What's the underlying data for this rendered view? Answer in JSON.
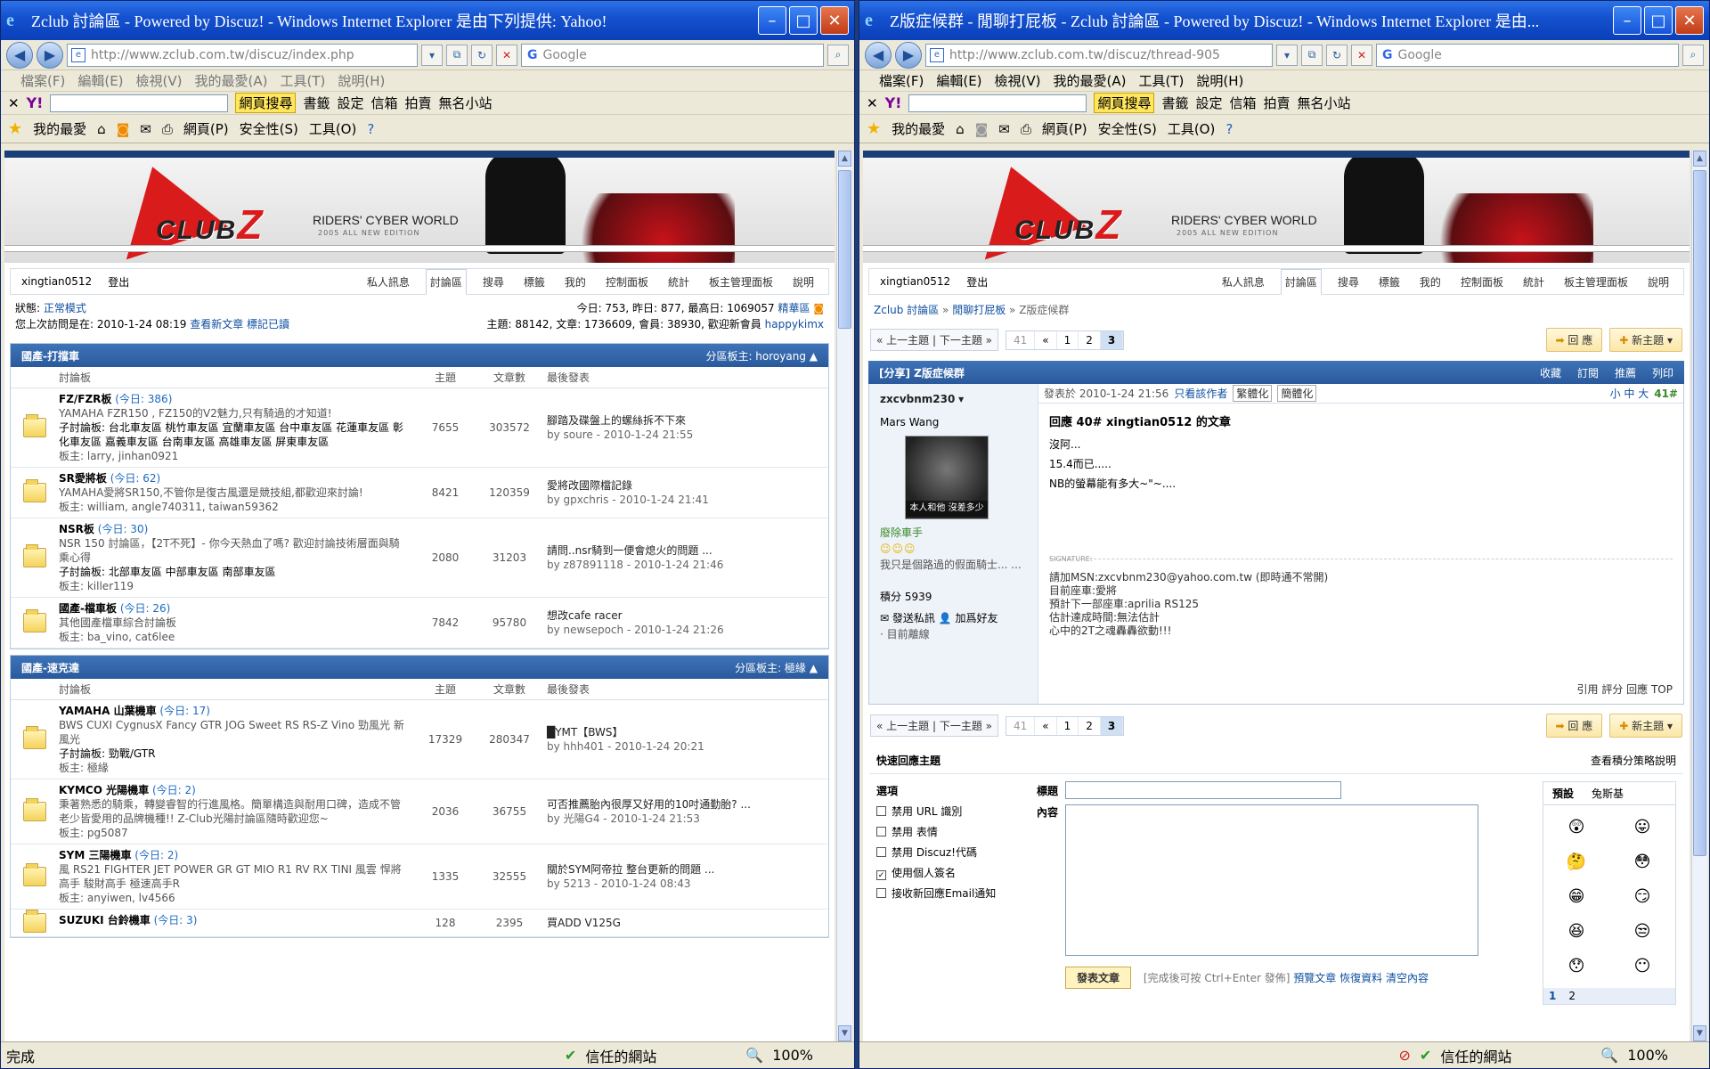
{
  "left": {
    "title": "Zclub 討論區 - Powered by Discuz! - Windows Internet Explorer 是由下列提供: Yahoo!",
    "url": "http://www.zclub.com.tw/discuz/index.php",
    "search_placeholder": "Google",
    "menu": [
      "檔案(F)",
      "編輯(E)",
      "檢視(V)",
      "我的最愛(A)",
      "工具(T)",
      "說明(H)"
    ],
    "yahoo": {
      "search_btn": "網頁搜尋",
      "items": [
        "書籤",
        "設定",
        "信箱",
        "拍賣",
        "無名小站"
      ]
    },
    "fav": {
      "label": "我的最愛",
      "items": [
        "網頁(P)",
        "安全性(S)",
        "工具(O)"
      ]
    },
    "status": {
      "text": "完成",
      "zone": "信任的網站",
      "zoom": "100%"
    },
    "forum": {
      "user": "xingtian0512",
      "logout": "登出",
      "tabs": [
        "私人訊息",
        "討論區",
        "搜尋",
        "標籤",
        "我的",
        "控制面板",
        "統計",
        "板主管理面板",
        "說明"
      ],
      "state_label": "狀態:",
      "state_value": "正常模式",
      "last_visit": "您上次訪問是在: 2010-1-24 08:19",
      "view_new": "查看新文章",
      "mark_read": "標記已讀",
      "today_stats": "今日: 753, 昨日: 877, 最高日: 1069057",
      "archive": "精華區",
      "totals": "主題: 88142, 文章: 1736609, 會員: 38930, 歡迎新會員",
      "new_member": "happykimx",
      "sections": [
        {
          "name": "國產-打擋車",
          "moderator": "分區板主: horoyang",
          "cols": [
            "討論板",
            "主題",
            "文章數",
            "最後發表"
          ],
          "rows": [
            {
              "name": "FZ/FZR板",
              "today": "(今日: 386)",
              "desc": "YAMAHA FZR150 , FZ150的V2魅力,只有騎過的才知道!",
              "sub": "子討論板: 台北車友區 桃竹車友區 宜蘭車友區 台中車友區 花蓮車友區 彰化車友區 嘉義車友區 台南車友區 高雄車友區 屏東車友區",
              "mods": "板主: larry, jinhan0921",
              "topics": "7655",
              "posts": "303572",
              "last_title": "腳踏及碟盤上的螺絲拆不下來",
              "last_by": "by soure - 2010-1-24 21:55"
            },
            {
              "name": "SR愛將板",
              "today": "(今日: 62)",
              "desc": "YAMAHA愛將SR150,不管你是復古風還是競技組,都歡迎來討論!",
              "sub": "",
              "mods": "板主: william, angle740311, taiwan59362",
              "topics": "8421",
              "posts": "120359",
              "last_title": "愛將改國際檔記錄",
              "last_by": "by gpxchris - 2010-1-24 21:41"
            },
            {
              "name": "NSR板",
              "today": "(今日: 30)",
              "desc": "NSR 150 討論區，【2T不死】- 你今天熱血了嗎? 歡迎討論技術層面與騎乘心得",
              "sub": "子討論板: 北部車友區 中部車友區 南部車友區",
              "mods": "板主: killer119",
              "topics": "2080",
              "posts": "31203",
              "last_title": "請問..nsr騎到一便會熄火的問題 ...",
              "last_by": "by z87891118 - 2010-1-24 21:46"
            },
            {
              "name": "國產-檔車板",
              "today": "(今日: 26)",
              "desc": "其他國產檔車綜合討論板",
              "sub": "",
              "mods": "板主: ba_vino, cat6lee",
              "topics": "7842",
              "posts": "95780",
              "last_title": "想改cafe racer",
              "last_by": "by newsepoch - 2010-1-24 21:26"
            }
          ]
        },
        {
          "name": "國產-速克達",
          "moderator": "分區板主: 極緣",
          "cols": [
            "討論板",
            "主題",
            "文章數",
            "最後發表"
          ],
          "rows": [
            {
              "name": "YAMAHA 山葉機車",
              "today": "(今日: 17)",
              "desc": "BWS CUXI CygnusX Fancy GTR JOG Sweet RS RS-Z Vino 勁風光 新風光",
              "sub": "子討論板: 勁戰/GTR",
              "mods": "板主: 極緣",
              "topics": "17329",
              "posts": "280347",
              "last_title": "█YMT【BWS】",
              "last_by": "by hhh401 - 2010-1-24 20:21"
            },
            {
              "name": "KYMCO 光陽機車",
              "today": "(今日: 2)",
              "desc": "秉著熟悉的騎乘，轉變睿智的行進風格。簡單構造與耐用口碑，造成不管老少皆愛用的品牌機種!! Z-Club光陽討論區隨時歡迎您~",
              "sub": "",
              "mods": "板主: pg5087",
              "topics": "2036",
              "posts": "36755",
              "last_title": "可否推薦胎內很厚又好用的10吋通勤胎? ...",
              "last_by": "by 光陽G4 - 2010-1-24 21:53"
            },
            {
              "name": "SYM 三陽機車",
              "today": "(今日: 2)",
              "desc": "風 RS21 FIGHTER JET POWER GR GT MIO R1 RV RX TINI 風雲 悍將 高手 駿財高手 極速高手R",
              "sub": "",
              "mods": "板主: anyiwen, lv4566",
              "topics": "1335",
              "posts": "32555",
              "last_title": "關於SYM阿帝拉 整台更新的問題 ...",
              "last_by": "by 5213 - 2010-1-24 08:43"
            },
            {
              "name": "SUZUKI 台鈴機車",
              "today": "(今日: 3)",
              "desc": "",
              "sub": "",
              "mods": "",
              "topics": "128",
              "posts": "2395",
              "last_title": "買ADD V125G",
              "last_by": ""
            }
          ]
        }
      ]
    }
  },
  "right": {
    "title": "Z版症候群 - 閒聊打屁板 - Zclub 討論區 - Powered by Discuz! - Windows Internet Explorer 是由...",
    "url": "http://www.zclub.com.tw/discuz/thread-905",
    "search_placeholder": "Google",
    "menu": [
      "檔案(F)",
      "編輯(E)",
      "檢視(V)",
      "我的最愛(A)",
      "工具(T)",
      "說明(H)"
    ],
    "yahoo": {
      "search_btn": "網頁搜尋",
      "items": [
        "書籤",
        "設定",
        "信箱",
        "拍賣",
        "無名小站"
      ]
    },
    "fav": {
      "label": "我的最愛",
      "items": [
        "網頁(P)",
        "安全性(S)",
        "工具(O)"
      ]
    },
    "status": {
      "zone": "信任的網站",
      "zoom": "100%"
    },
    "forum": {
      "user": "xingtian0512",
      "logout": "登出",
      "tabs": [
        "私人訊息",
        "討論區",
        "搜尋",
        "標籤",
        "我的",
        "控制面板",
        "統計",
        "板主管理面板",
        "說明"
      ],
      "crumbs": [
        "Zclub 討論區",
        "閒聊打屁板",
        "Z版症候群"
      ],
      "prev_next": "« 上一主題 | 下一主題 »",
      "pages": [
        "41",
        "«",
        "1",
        "2",
        "3"
      ],
      "reply_btn": "回 應",
      "new_btn": "新主題",
      "thread_title": "[分享] Z版症候群",
      "thread_actions": [
        "收藏",
        "訂閱",
        "推薦",
        "列印"
      ],
      "post": {
        "author": "zxcvbnm230",
        "realname": "Mars Wang",
        "avatar_caption": "本人和他 沒差多少",
        "rank": "廢除車手",
        "stars": "☺☺☺",
        "bio": "我只是個路過的假面騎士... ...",
        "points_label": "積分",
        "points": "5939",
        "send_pm": "發送私訊",
        "add_friend": "加爲好友",
        "offline": "目前離線",
        "posted": "發表於 2010-1-24 21:56",
        "only_author": "只看該作者",
        "trad": "繁體化",
        "simp": "簡體化",
        "sizes": "小 中 大",
        "floor": "41#",
        "title": "回應 40# xingtian0512 的文章",
        "lines": [
          "沒阿...",
          "15.4而已.....",
          "NB的螢幕能有多大~\"~...."
        ],
        "sig_label": "SIGNATURE:",
        "sig": [
          "請加MSN:zxcvbnm230@yahoo.com.tw (即時通不常開)",
          "目前座車:愛將",
          "預計下一部座車:aprilia RS125",
          "估計達成時間:無法估計",
          "心中的2T之魂轟轟欲動!!!"
        ],
        "footer": "引用 評分 回應 TOP"
      },
      "quick_reply": {
        "head": "快速回應主題",
        "rules": "查看積分策略說明",
        "options_label": "選項",
        "options": [
          "禁用 URL 識別",
          "禁用 表情",
          "禁用 Discuz!代碼",
          "使用個人簽名",
          "接收新回應Email通知"
        ],
        "checked": [
          false,
          false,
          false,
          true,
          false
        ],
        "title_label": "標題",
        "content_label": "內容",
        "send": "發表文章",
        "hint": "[完成後可按 Ctrl+Enter 發佈]",
        "links": [
          "預覽文章",
          "恢復資料",
          "清空內容"
        ],
        "smiley_tabs": [
          "預設",
          "兔斯基"
        ],
        "smileys": [
          "😲",
          "😛",
          "🤔",
          "😳",
          "😁",
          "😏",
          "😆",
          "😒",
          "😯",
          "😶"
        ],
        "smiley_pages": [
          "1",
          "2"
        ]
      }
    }
  }
}
